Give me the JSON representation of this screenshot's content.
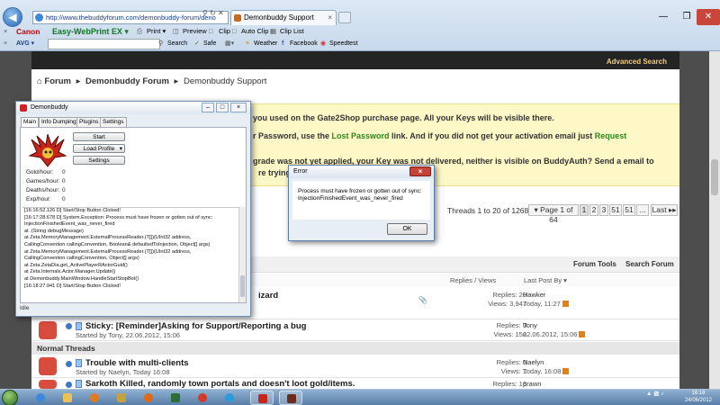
{
  "browser": {
    "url": "http://www.thebuddyforum.com/demonbuddy-forum/deno",
    "tab_title": "Demonbuddy Support",
    "toolbar": {
      "canon": "Canon",
      "easy_webprint": "Easy-WebPrint EX ▾",
      "print": "Print ▾",
      "preview": "Preview",
      "clip": "Clip",
      "auto_clip": "Auto Clip",
      "clip_list": "Clip List"
    },
    "avg_bar": {
      "avg": "AVG ▾",
      "search": "Search",
      "safe": "Safe",
      "weather": "Weather",
      "facebook": "Facebook",
      "speedtest": "Speedtest"
    }
  },
  "forum": {
    "advanced_search": "Advanced Search",
    "breadcrumb": [
      "Forum",
      "Demonbuddy Forum",
      "Demonbuddy Support"
    ],
    "notice_lines": [
      "you used on the Gate2Shop purchase page. All your Keys will be visible there.",
      "r Password, use the ",
      "Lost Password",
      " link. And if you did not get your activation email just ",
      "Request",
      "grade was not yet applied, your Key was not delivered, neither is visible on BuddyAuth? Send a email to",
      "re trying"
    ],
    "pagination": {
      "summary": "Threads 1 to 20 of 1268",
      "page_of": "▾ Page 1 of 64",
      "pages": [
        "1",
        "2",
        "3",
        "51",
        "51",
        "..."
      ],
      "last": "Last ▸▸"
    },
    "forum_tools": "Forum Tools",
    "search_forum": "Search Forum",
    "columns": {
      "replies_views": "Replies / Views",
      "last_post_by": "Last Post By ▾"
    },
    "threads_partial": {
      "title_fragment": "izard",
      "replies": "Replies: 20",
      "views": "Views: 3,947",
      "last_by": "Hawker",
      "last_time": "Today, 11:27"
    },
    "sticky_thread": {
      "title": "Sticky: [Reminder]Asking for Support/Reporting a bug",
      "started": "Started by Tony, 22.06.2012, 15:06",
      "replies": "Replies: 0",
      "views": "Views: 156",
      "last_by": "Tony",
      "last_time": "22.06.2012, 15:06"
    },
    "normal_threads_header": "Normal Threads",
    "normal_threads": [
      {
        "title": "Trouble with multi-clients",
        "started": "Started by Naelyn, Today 16:08",
        "replies": "Replies: 0",
        "views": "Views: 1",
        "last_by": "Naelyn",
        "last_time": "Today, 16:08"
      },
      {
        "title": "Sarkoth Killed, randomly town portals and doesn't loot gold/items.",
        "started": "",
        "replies": "Replies: 16",
        "views": "",
        "last_by": "prawn",
        "last_time": ""
      }
    ]
  },
  "demonbuddy": {
    "title": "Demonbuddy",
    "tabs": [
      "Main",
      "Info Dumping",
      "Plugins",
      "Settings"
    ],
    "buttons": {
      "start": "Start",
      "load_profile": "Load Profile",
      "settings": "Settings"
    },
    "stats": [
      {
        "label": "Gold/hour:",
        "value": "0"
      },
      {
        "label": "Games/hour:",
        "value": "0"
      },
      {
        "label": "Deaths/hour:",
        "value": "0"
      },
      {
        "label": "Exp/hour:",
        "value": "0"
      }
    ],
    "log": [
      "[16:16:52.126 D] Start/Stop Button Clicked!",
      "[16:17:28.678 D] System.Exception: Process must have frozen or gotten out of sync:",
      "InjectionFinishedEvent_was_never_fired",
      "   at .(String debugMessage)",
      "   at Zeta.MemoryManagement.ExternalProcessReader.(T[])(UInt32 address,",
      "CallingConvention callingConvention, Boolean& defaultedToInjection, Object[] args)",
      "   at Zeta.MemoryManagement.ExternalProcessReader.(T[])(UInt32 address,",
      "CallingConvention callingConvention, Object[] args)",
      "   at Zeta.ZetaDia.get_ActivePlayerRActorGuid()",
      "   at Zeta.Internals.Actor.Manager.Update()",
      "   at Demonbuddy.MainWindow.HandleStartStopBot()",
      "[16:18:27.941 D] Start/Stop Button Clicked!"
    ],
    "status": "Idle"
  },
  "error_dialog": {
    "title": "Error",
    "message_line1": "Process must have frozen or gotten out of sync:",
    "message_line2": "InjectionFinishedEvent_was_never_fired",
    "ok": "OK"
  },
  "taskbar": {
    "time": "16:18",
    "date": "24/06/2012"
  },
  "colors": {
    "accent_orange": "#e3800f",
    "link_green": "#2a8a1a",
    "notice_bg": "#fef7c6",
    "error_close": "#c7433a"
  }
}
